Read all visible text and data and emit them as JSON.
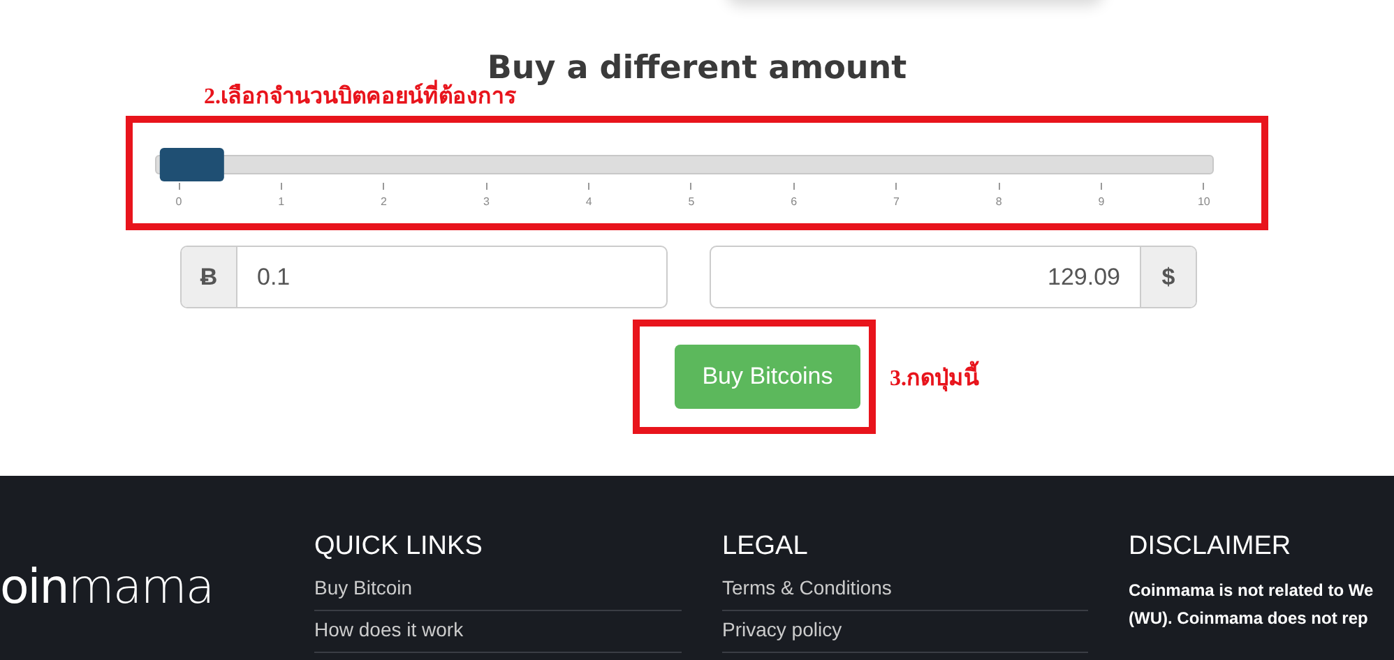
{
  "heading": "Buy a different amount",
  "annotations": [
    {
      "text": "2.เลือกจำนวนบิตคอยน์ที่ต้องการ"
    },
    {
      "text": "3.กดปุ่มนี้"
    }
  ],
  "slider": {
    "level": 0.01,
    "ticks": [
      "0",
      "1",
      "2",
      "3",
      "4",
      "5",
      "6",
      "7",
      "8",
      "9",
      "10"
    ]
  },
  "btc_field": {
    "addon": "Ƀ",
    "value": "0.1"
  },
  "usd_field": {
    "addon": "$",
    "value": "129.09"
  },
  "buy_button": "Buy Bitcoins",
  "footer": {
    "logo": "**oin**mama",
    "columns": [
      {
        "title": "QUICK LINKS",
        "links": [
          "Buy Bitcoin",
          "How does it work"
        ]
      },
      {
        "title": "LEGAL",
        "links": [
          "Terms & Conditions",
          "Privacy policy"
        ]
      }
    ],
    "disclaimer": {
      "title": "DISCLAIMER",
      "lines": [
        "Coinmama is not related to We",
        "(WU). Coinmama does not rep"
      ]
    }
  }
}
